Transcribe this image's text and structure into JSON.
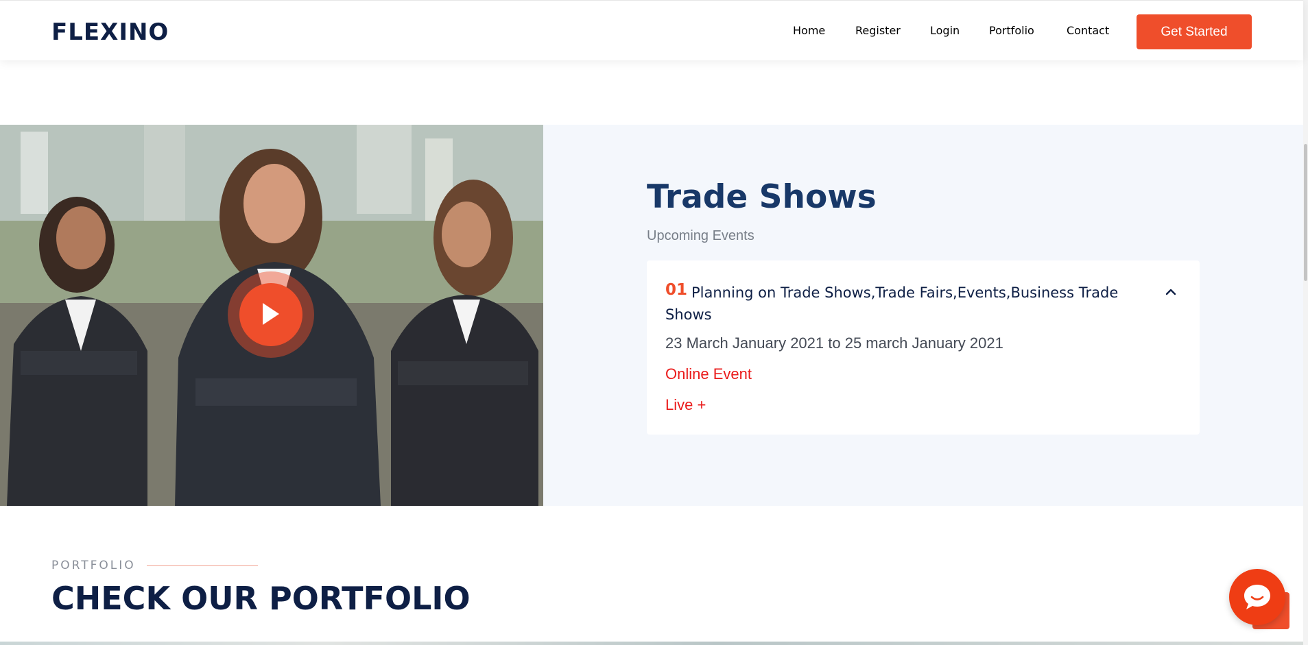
{
  "header": {
    "logo": "FLEXINO",
    "nav": [
      "Home",
      "Register",
      "Login",
      "Portfolio",
      "Contact"
    ],
    "cta": "Get Started"
  },
  "hero": {
    "title": "Trade Shows",
    "subtitle": "Upcoming Events",
    "play_icon": "play-icon"
  },
  "event": {
    "number": "01",
    "title": "Planning on Trade Shows,Trade Fairs,Events,Business Trade Shows",
    "date": "23 March January 2021 to 25 march January 2021",
    "type": "Online Event",
    "live": "Live +",
    "toggle_icon": "chevron-up-icon"
  },
  "portfolio": {
    "label": "PORTFOLIO",
    "title": "CHECK OUR PORTFOLIO"
  },
  "colors": {
    "accent": "#ef4e2b",
    "navy": "#0e1f45",
    "title_blue": "#183868",
    "red_text": "#ea1b1b",
    "section_bg": "#f4f7fc"
  },
  "floating": {
    "chat_icon": "chat-icon",
    "back_to_top_icon": "arrow-up-icon"
  }
}
